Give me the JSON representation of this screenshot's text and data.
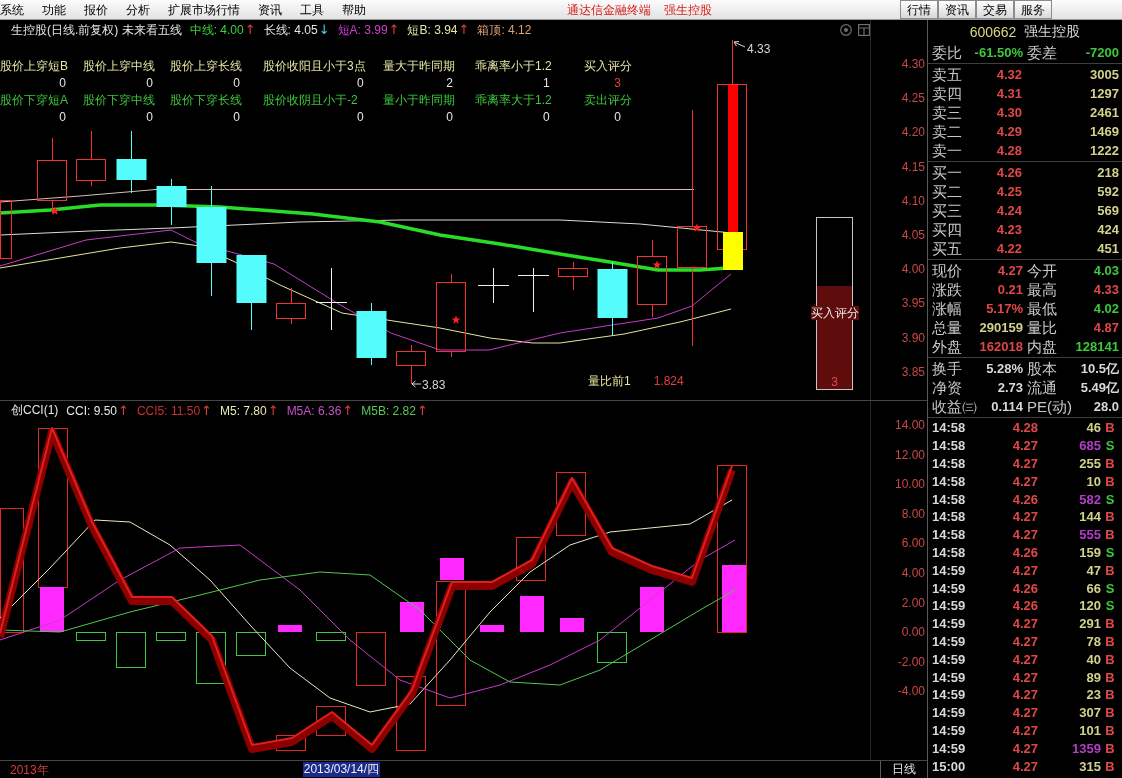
{
  "menu_bar": {
    "items": [
      "系统",
      "功能",
      "报价",
      "分析",
      "扩展市场行情",
      "资讯",
      "工具",
      "帮助"
    ],
    "app_title": "通达信金融终端",
    "stock_title": "强生控股",
    "view_tabs": [
      "行情",
      "资讯",
      "交易",
      "服务"
    ]
  },
  "chart_header": {
    "title": "生控股(日线.前复权) 未来看五线",
    "indicators": [
      {
        "text": "中线: 4.00",
        "arrow": "↑",
        "falling": false,
        "color": "#3cd23c"
      },
      {
        "text": "长线: 4.05",
        "arrow": "↓",
        "falling": true,
        "color": "#e6e6e6"
      },
      {
        "text": "短A: 3.99",
        "arrow": "↑",
        "falling": false,
        "color": "#d23cd2"
      },
      {
        "text": "短B: 3.94",
        "arrow": "↑",
        "falling": false,
        "color": "#e6e6aa"
      },
      {
        "text": "箱顶: 4.12",
        "color": "#e0a070"
      }
    ]
  },
  "signals": [
    {
      "kind": "buy",
      "items": [
        {
          "label": "股价上穿短B",
          "value": "0",
          "kind": "condition"
        },
        {
          "label": "股价上穿中线",
          "value": "0",
          "kind": "condition"
        },
        {
          "label": "股价上穿长线",
          "value": "0",
          "kind": "condition"
        },
        {
          "label": "股价收阳且小于3点",
          "value": "0",
          "kind": "condition"
        },
        {
          "label": "量大于昨同期",
          "value": "2",
          "kind": "condition"
        },
        {
          "label": "乖离率小于1.2",
          "value": "1",
          "kind": "condition"
        },
        {
          "label": "买入评分",
          "value": "3",
          "kind": "score"
        }
      ]
    },
    {
      "kind": "sell",
      "items": [
        {
          "label": "股价下穿短A",
          "value": "0",
          "kind": "condition"
        },
        {
          "label": "股价下穿中线",
          "value": "0",
          "kind": "condition"
        },
        {
          "label": "股价下穿长线",
          "value": "0",
          "kind": "condition"
        },
        {
          "label": "股价收阴且小于-2",
          "value": "0",
          "kind": "condition"
        },
        {
          "label": "量小于昨同期",
          "value": "0",
          "kind": "condition"
        },
        {
          "label": "乖离率大于1.2",
          "value": "0",
          "kind": "condition"
        },
        {
          "label": "卖出评分",
          "value": "0",
          "kind": "score"
        }
      ]
    }
  ],
  "price_chart": {
    "axis_labels": [
      "4.30",
      "4.25",
      "4.20",
      "4.15",
      "4.10",
      "4.05",
      "4.00",
      "3.95",
      "3.90",
      "3.85"
    ],
    "high_label": "4.33",
    "low_label": "3.83",
    "volume_ratio": {
      "label": "量比前1",
      "value": "1.824"
    },
    "score_meter": {
      "label": "买入评分",
      "value": "3",
      "level": 0.6
    }
  },
  "cci_chart": {
    "title": "创CCI(1)",
    "indicators": [
      {
        "text": "CCI: 9.50",
        "arrow": "↑",
        "falling": false,
        "color": "#e8e8e8"
      },
      {
        "text": "CCI5: 11.50",
        "arrow": "↑",
        "falling": false,
        "color": "#c83232"
      },
      {
        "text": "M5: 7.80",
        "arrow": "↑",
        "falling": false,
        "color": "#e8e8b4"
      },
      {
        "text": "M5A: 6.36",
        "arrow": "↑",
        "falling": false,
        "color": "#c850c8"
      },
      {
        "text": "M5B: 2.82",
        "arrow": "↑",
        "falling": false,
        "color": "#5ac85a"
      }
    ],
    "axis_labels": [
      "14.00",
      "12.00",
      "10.00",
      "8.00",
      "6.00",
      "4.00",
      "2.00",
      "0.00",
      "-2.00",
      "-4.00"
    ]
  },
  "bottom_bar": {
    "year": "2013年",
    "cursor_date": "2013/03/14/四",
    "period": "日线"
  },
  "quote_panel": {
    "code": "600662",
    "name": "强生控股",
    "commission": [
      {
        "label": "委比",
        "value": "-61.50%",
        "color": "#3cc83c"
      },
      {
        "label": "委差",
        "value": "-7200",
        "color": "#3cc83c"
      }
    ],
    "asks": [
      {
        "label": "卖五",
        "price": "4.32",
        "volume": "3005"
      },
      {
        "label": "卖四",
        "price": "4.31",
        "volume": "1297"
      },
      {
        "label": "卖三",
        "price": "4.30",
        "volume": "2461"
      },
      {
        "label": "卖二",
        "price": "4.29",
        "volume": "1469"
      },
      {
        "label": "卖一",
        "price": "4.28",
        "volume": "1222"
      }
    ],
    "bids": [
      {
        "label": "买一",
        "price": "4.26",
        "volume": "218"
      },
      {
        "label": "买二",
        "price": "4.25",
        "volume": "592"
      },
      {
        "label": "买三",
        "price": "4.24",
        "volume": "569"
      },
      {
        "label": "买四",
        "price": "4.23",
        "volume": "424"
      },
      {
        "label": "买五",
        "price": "4.22",
        "volume": "451"
      }
    ],
    "stats": [
      {
        "label": "现价",
        "value": "4.27",
        "color": "#e04848"
      },
      {
        "label": "今开",
        "value": "4.03",
        "color": "#3cc83c"
      },
      {
        "label": "涨跌",
        "value": "0.21",
        "color": "#e04848"
      },
      {
        "label": "最高",
        "value": "4.33",
        "color": "#e04848"
      },
      {
        "label": "涨幅",
        "value": "5.17%",
        "color": "#e04848"
      },
      {
        "label": "最低",
        "value": "4.02",
        "color": "#3cc83c"
      },
      {
        "label": "总量",
        "value": "290159",
        "color": "#d2d28c"
      },
      {
        "label": "量比",
        "value": "4.87",
        "color": "#e04848"
      },
      {
        "label": "外盘",
        "value": "162018",
        "color": "#e04848"
      },
      {
        "label": "内盘",
        "value": "128141",
        "color": "#3cc83c"
      }
    ],
    "fundamentals": [
      {
        "label": "换手",
        "value": "5.28%"
      },
      {
        "label": "股本",
        "value": "10.5亿"
      },
      {
        "label": "净资",
        "value": "2.73"
      },
      {
        "label": "流通",
        "value": "5.49亿"
      },
      {
        "label": "收益㈢",
        "value": "0.114"
      },
      {
        "label": "PE(动)",
        "value": "28.0"
      }
    ],
    "trades": [
      {
        "time": "14:58",
        "price": "4.28",
        "volume": "46",
        "side": "B",
        "buy": true,
        "large": false
      },
      {
        "time": "14:58",
        "price": "4.27",
        "volume": "685",
        "side": "S",
        "buy": false,
        "large": true
      },
      {
        "time": "14:58",
        "price": "4.27",
        "volume": "255",
        "side": "B",
        "buy": true,
        "large": false
      },
      {
        "time": "14:58",
        "price": "4.27",
        "volume": "10",
        "side": "B",
        "buy": true,
        "large": false
      },
      {
        "time": "14:58",
        "price": "4.26",
        "volume": "582",
        "side": "S",
        "buy": false,
        "large": true
      },
      {
        "time": "14:58",
        "price": "4.27",
        "volume": "144",
        "side": "B",
        "buy": true,
        "large": false
      },
      {
        "time": "14:58",
        "price": "4.27",
        "volume": "555",
        "side": "B",
        "buy": true,
        "large": true
      },
      {
        "time": "14:58",
        "price": "4.26",
        "volume": "159",
        "side": "S",
        "buy": false,
        "large": false
      },
      {
        "time": "14:59",
        "price": "4.27",
        "volume": "47",
        "side": "B",
        "buy": true,
        "large": false
      },
      {
        "time": "14:59",
        "price": "4.26",
        "volume": "66",
        "side": "S",
        "buy": false,
        "large": false
      },
      {
        "time": "14:59",
        "price": "4.26",
        "volume": "120",
        "side": "S",
        "buy": false,
        "large": false
      },
      {
        "time": "14:59",
        "price": "4.27",
        "volume": "291",
        "side": "B",
        "buy": true,
        "large": false
      },
      {
        "time": "14:59",
        "price": "4.27",
        "volume": "78",
        "side": "B",
        "buy": true,
        "large": false
      },
      {
        "time": "14:59",
        "price": "4.27",
        "volume": "40",
        "side": "B",
        "buy": true,
        "large": false
      },
      {
        "time": "14:59",
        "price": "4.27",
        "volume": "89",
        "side": "B",
        "buy": true,
        "large": false
      },
      {
        "time": "14:59",
        "price": "4.27",
        "volume": "23",
        "side": "B",
        "buy": true,
        "large": false
      },
      {
        "time": "14:59",
        "price": "4.27",
        "volume": "307",
        "side": "B",
        "buy": true,
        "large": false
      },
      {
        "time": "14:59",
        "price": "4.27",
        "volume": "101",
        "side": "B",
        "buy": true,
        "large": false
      },
      {
        "time": "14:59",
        "price": "4.27",
        "volume": "1359",
        "side": "B",
        "buy": true,
        "large": true
      },
      {
        "time": "15:00",
        "price": "4.27",
        "volume": "315",
        "side": "B",
        "buy": true,
        "large": false
      }
    ]
  }
}
